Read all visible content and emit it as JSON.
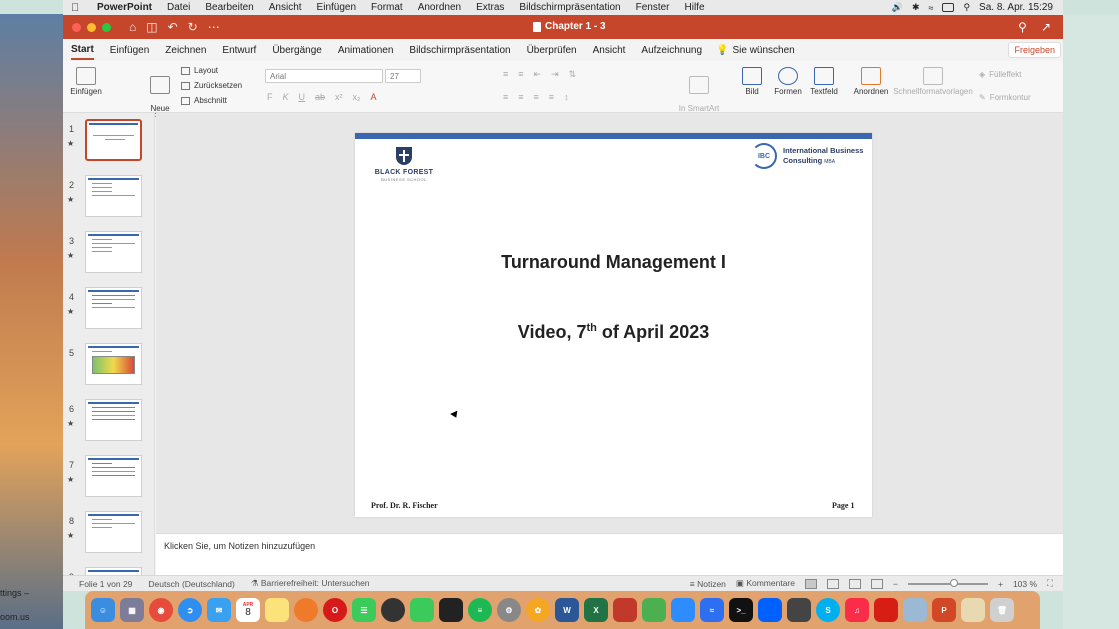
{
  "menubar": {
    "app_name": "PowerPoint",
    "items": [
      "Datei",
      "Bearbeiten",
      "Ansicht",
      "Einfügen",
      "Format",
      "Anordnen",
      "Extras",
      "Bildschirmpräsentation",
      "Fenster",
      "Hilfe"
    ],
    "clock": "Sa. 8. Apr.  15:29"
  },
  "window": {
    "title": "Chapter 1 - 3"
  },
  "ribbon_tabs": {
    "items": [
      "Start",
      "Einfügen",
      "Zeichnen",
      "Entwurf",
      "Übergänge",
      "Animationen",
      "Bildschirmpräsentation",
      "Überprüfen",
      "Ansicht",
      "Aufzeichnung"
    ],
    "active": "Start",
    "help": "Sie wünschen",
    "share": "Freigeben"
  },
  "ribbon": {
    "paste": "Einfügen",
    "new_slide": "Neue\nFolie",
    "layout": "Layout",
    "reset": "Zurücksetzen",
    "section": "Abschnitt",
    "font_name": "Arial",
    "font_size": "27",
    "smartart": "In SmartArt\nkonvertieren",
    "picture": "Bild",
    "shapes": "Formen",
    "textbox": "Textfeld",
    "arrange": "Anordnen",
    "quick_styles": "Schnellformatvorlagen",
    "fill_effect": "Fülleffekt",
    "shape_outline": "Formkontur"
  },
  "thumbnails": {
    "numbers": [
      "1",
      "2",
      "3",
      "4",
      "5",
      "6",
      "7",
      "8",
      "9"
    ],
    "selected": "1"
  },
  "slide": {
    "logo_left_name": "BLACK FOREST",
    "logo_left_sub": "BUSINESS SCHOOL",
    "logo_right_mark": "IBC",
    "logo_right_line1": "International Business",
    "logo_right_line2": "Consulting",
    "logo_right_suffix": "MBA",
    "title": "Turnaround Management I",
    "subtitle_pre": "Video, 7",
    "subtitle_sup": "th",
    "subtitle_post": " of April 2023",
    "footer_author": "Prof. Dr. R. Fischer",
    "footer_page": "Page 1"
  },
  "notes": {
    "placeholder": "Klicken Sie, um Notizen hinzuzufügen"
  },
  "status_bar": {
    "slide_counter": "Folie 1 von 29",
    "language": "Deutsch (Deutschland)",
    "accessibility": "Barrierefreiheit: Untersuchen",
    "notes": "Notizen",
    "comments": "Kommentare",
    "zoom": "103 %"
  },
  "desktop_fragments": [
    "ttings –",
    "oom.us"
  ],
  "dock": {
    "calendar_month": "APR",
    "calendar_day": "8"
  },
  "colors": {
    "accent": "#c5462b",
    "slide_bar": "#3a67b0"
  }
}
